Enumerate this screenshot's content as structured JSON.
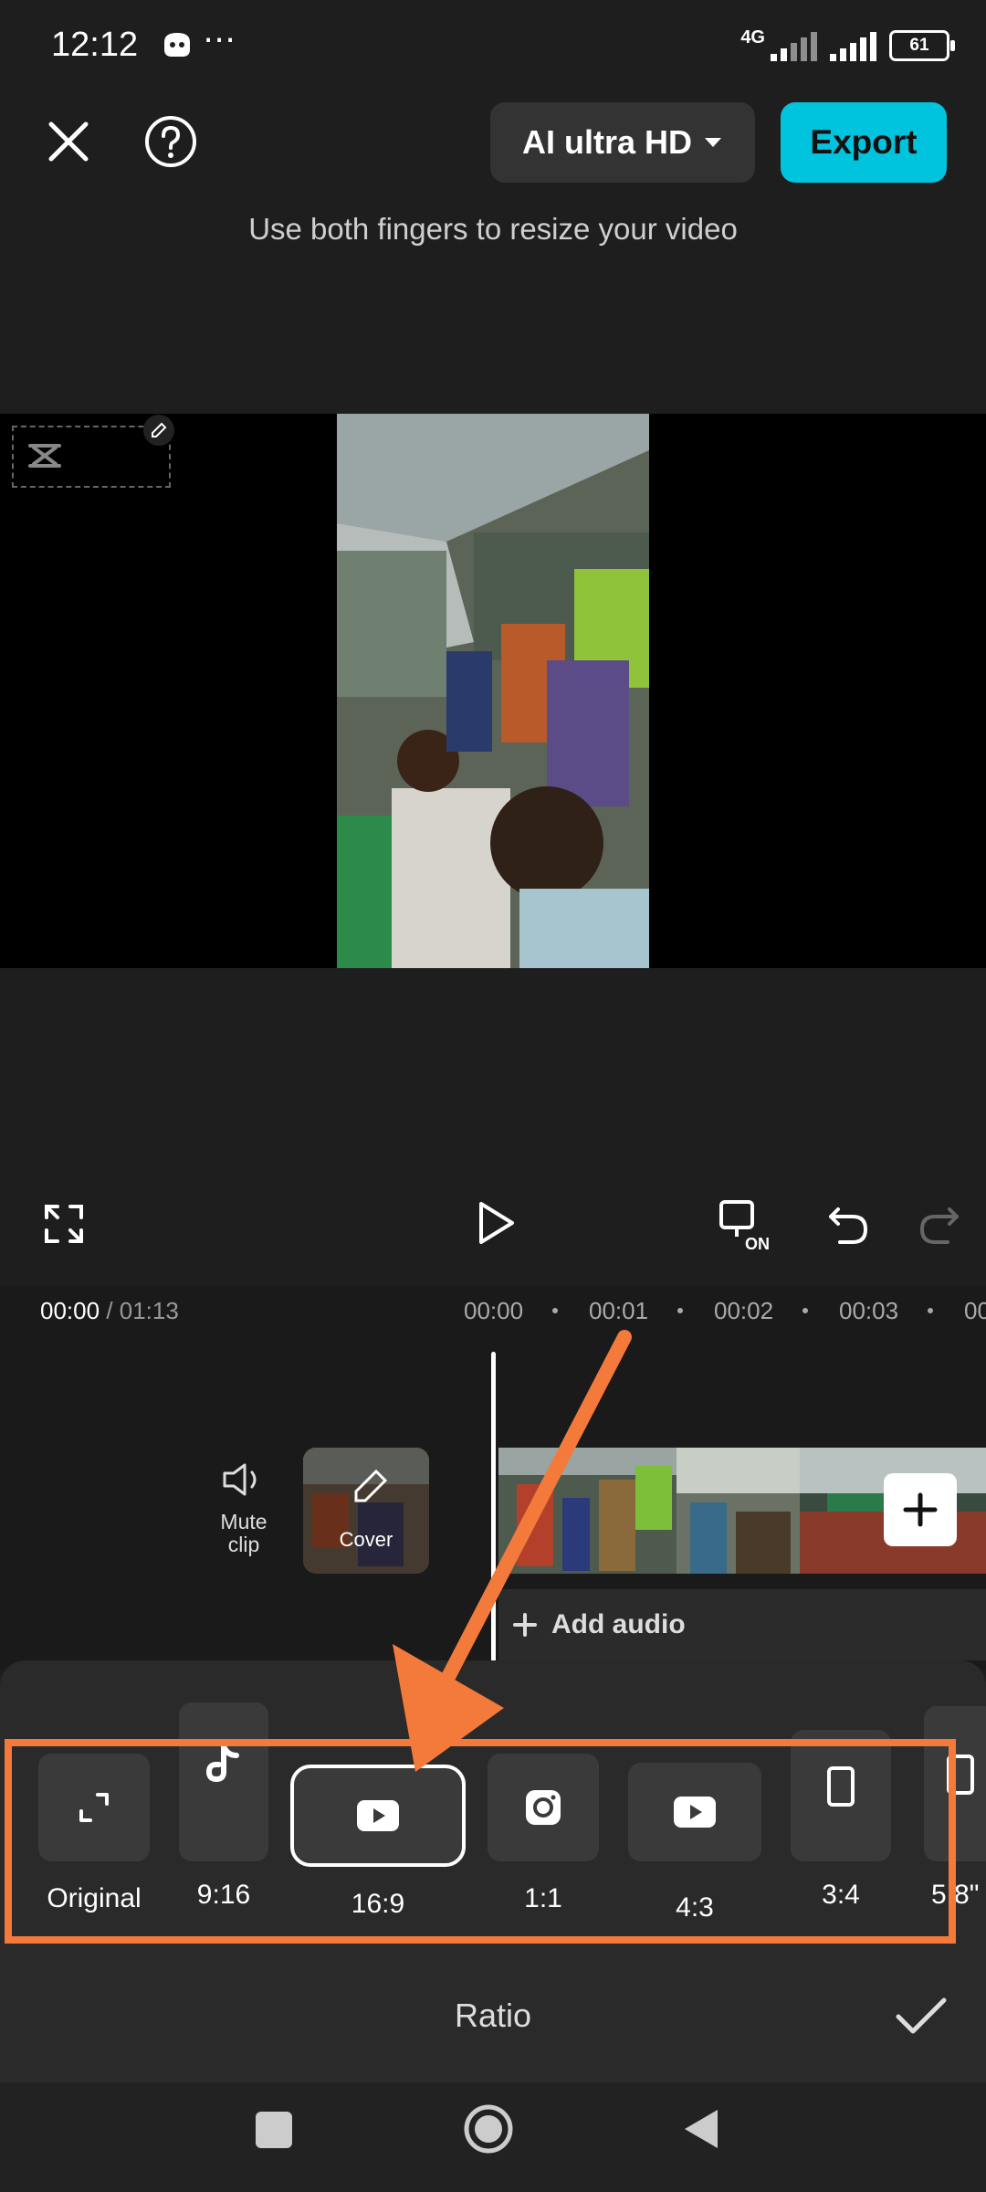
{
  "status": {
    "time": "12:12",
    "extra": "⋯",
    "network": "4G",
    "battery": "61"
  },
  "header": {
    "quality_label": "AI ultra HD",
    "export_label": "Export"
  },
  "hint": "Use both fingers to resize your video",
  "timeline": {
    "current": "00:00",
    "total": "/ 01:13",
    "ruler": [
      "00:00",
      "00:01",
      "00:02",
      "00:03",
      "00"
    ],
    "mute_label": "Mute clip",
    "cover_label": "Cover",
    "add_audio": "Add audio"
  },
  "ratios": [
    {
      "label": "Original",
      "icon": "expand-icon"
    },
    {
      "label": "9:16",
      "icon": "tiktok-icon"
    },
    {
      "label": "16:9",
      "icon": "youtube-icon",
      "selected": true
    },
    {
      "label": "1:1",
      "icon": "instagram-icon"
    },
    {
      "label": "4:3",
      "icon": "youtube-icon"
    },
    {
      "label": "3:4",
      "icon": "portrait-icon"
    },
    {
      "label": "5:8\"",
      "icon": "portrait-icon"
    }
  ],
  "panel_title": "Ratio",
  "colors": {
    "accent": "#00c3dd",
    "annotation": "#f47a3c"
  }
}
